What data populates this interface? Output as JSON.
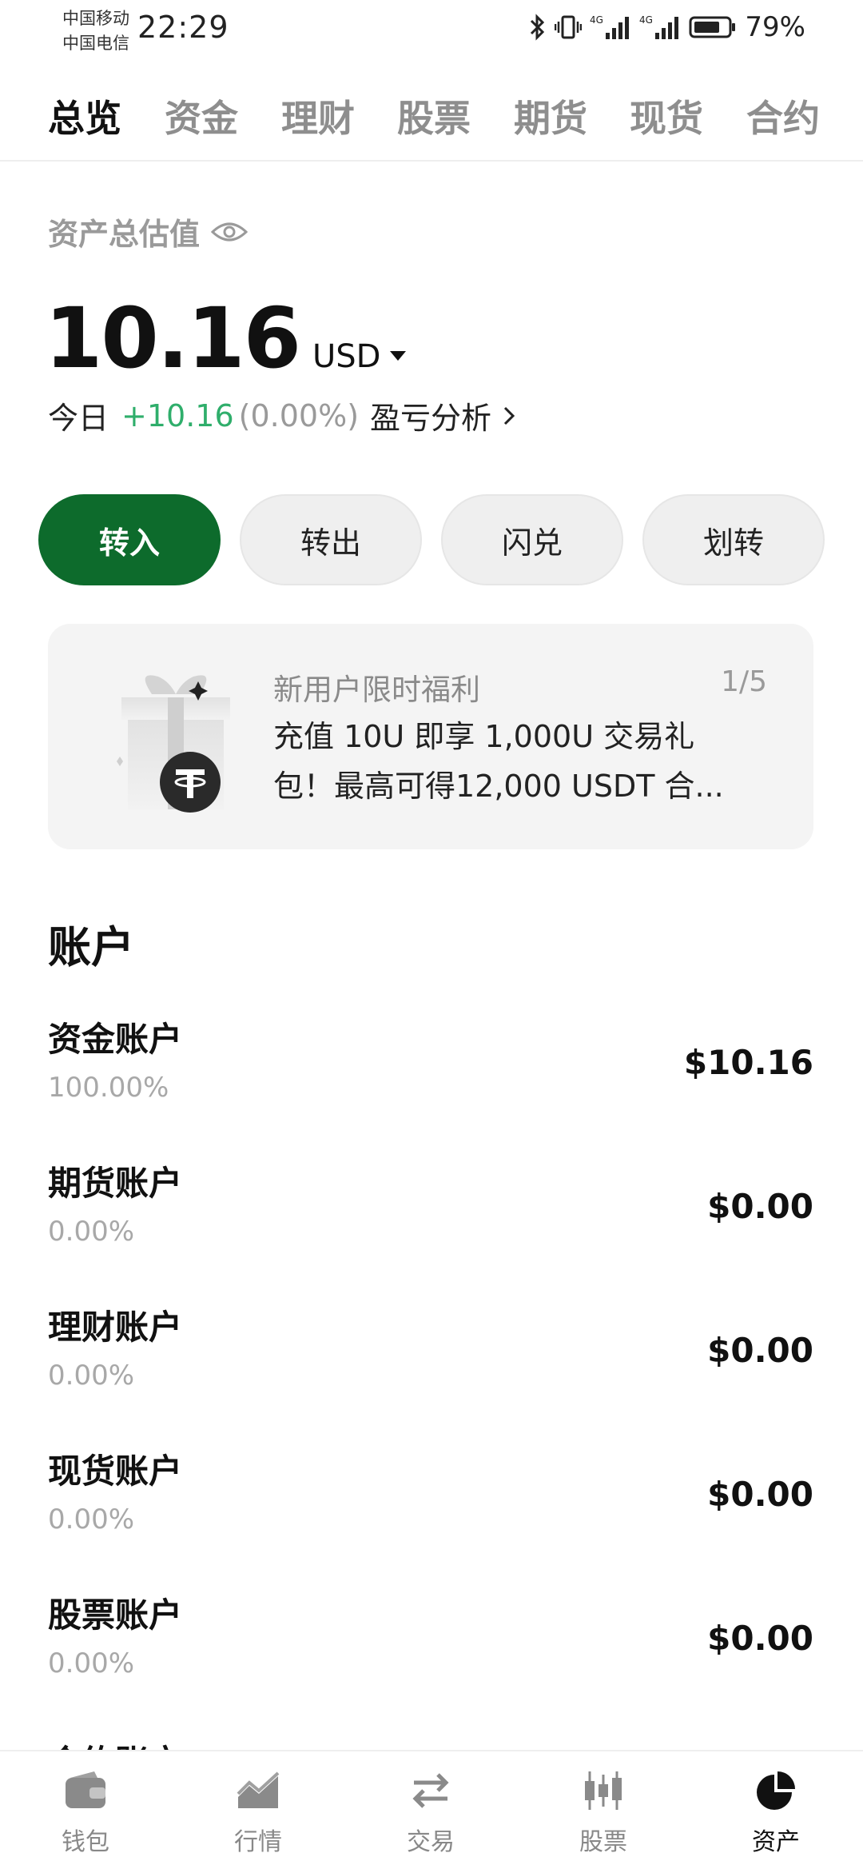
{
  "status_bar": {
    "carrier_1": "中国移动",
    "carrier_2": "中国电信",
    "time": "22:29",
    "battery": "79%",
    "icons": [
      "bluetooth-icon",
      "vibrate-icon",
      "signal-4g-icon",
      "signal-4g-icon",
      "battery-icon"
    ]
  },
  "tabs": [
    {
      "label": "总览",
      "active": true
    },
    {
      "label": "资金",
      "active": false
    },
    {
      "label": "理财",
      "active": false
    },
    {
      "label": "股票",
      "active": false
    },
    {
      "label": "期货",
      "active": false
    },
    {
      "label": "现货",
      "active": false
    },
    {
      "label": "合约",
      "active": false
    }
  ],
  "summary": {
    "label": "资产总估值",
    "value": "10.16",
    "currency": "USD",
    "today_label": "今日",
    "today_change": "+10.16",
    "today_pct": "(0.00%)",
    "analysis": "盈亏分析"
  },
  "actions": [
    {
      "label": "转入",
      "primary": true
    },
    {
      "label": "转出",
      "primary": false
    },
    {
      "label": "闪兑",
      "primary": false
    },
    {
      "label": "划转",
      "primary": false
    }
  ],
  "promo": {
    "title": "新用户限时福利",
    "page": "1/5",
    "line1": "充值 10U 即享 1,000U 交易礼",
    "line2": "包！最高可得12,000 USDT 合..."
  },
  "accounts_heading": "账户",
  "accounts": [
    {
      "name": "资金账户",
      "pct": "100.00%",
      "value": "$10.16"
    },
    {
      "name": "期货账户",
      "pct": "0.00%",
      "value": "$0.00"
    },
    {
      "name": "理财账户",
      "pct": "0.00%",
      "value": "$0.00"
    },
    {
      "name": "现货账户",
      "pct": "0.00%",
      "value": "$0.00"
    },
    {
      "name": "股票账户",
      "pct": "0.00%",
      "value": "$0.00"
    }
  ],
  "partial_account": "合约账户",
  "bottom_nav": [
    {
      "label": "钱包",
      "icon": "wallet-icon",
      "active": false
    },
    {
      "label": "行情",
      "icon": "market-chart-icon",
      "active": false
    },
    {
      "label": "交易",
      "icon": "trade-arrows-icon",
      "active": false
    },
    {
      "label": "股票",
      "icon": "candlestick-icon",
      "active": false
    },
    {
      "label": "资产",
      "icon": "pie-chart-icon",
      "active": true
    }
  ],
  "colors": {
    "accent": "#0d6b2c",
    "positive": "#2fae6b"
  }
}
